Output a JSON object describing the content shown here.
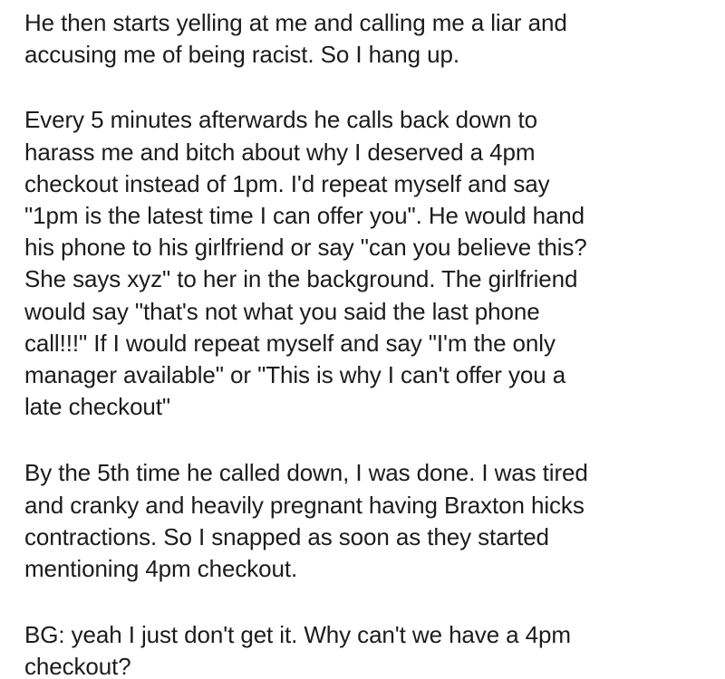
{
  "post": {
    "paragraphs": [
      {
        "lines": [
          "He then starts yelling at me and calling me a liar and",
          "accusing me of being racist. So I hang up."
        ]
      },
      {
        "lines": [
          "Every 5 minutes afterwards he calls back down to",
          "harass me and bitch about why I deserved a 4pm",
          "checkout instead of 1pm. I'd repeat myself and say",
          "\"1pm is the latest time I can offer you\". He would hand",
          "his phone to his girlfriend or say \"can you believe this?",
          "She says xyz\" to her in the background. The girlfriend",
          "would say \"that's not what you said the last phone",
          "call!!!\" If I would repeat myself and say \"I'm the only",
          "manager available\" or \"This is why I can't offer you a",
          "late checkout\""
        ]
      },
      {
        "lines": [
          "By the 5th time he called down, I was done. I was tired",
          "and cranky and heavily pregnant having Braxton hicks",
          "contractions.  So I snapped as soon as they started",
          "mentioning 4pm checkout."
        ]
      },
      {
        "lines": [
          "BG: yeah I just don't get it. Why can't we have a 4pm",
          "checkout?"
        ]
      }
    ]
  }
}
